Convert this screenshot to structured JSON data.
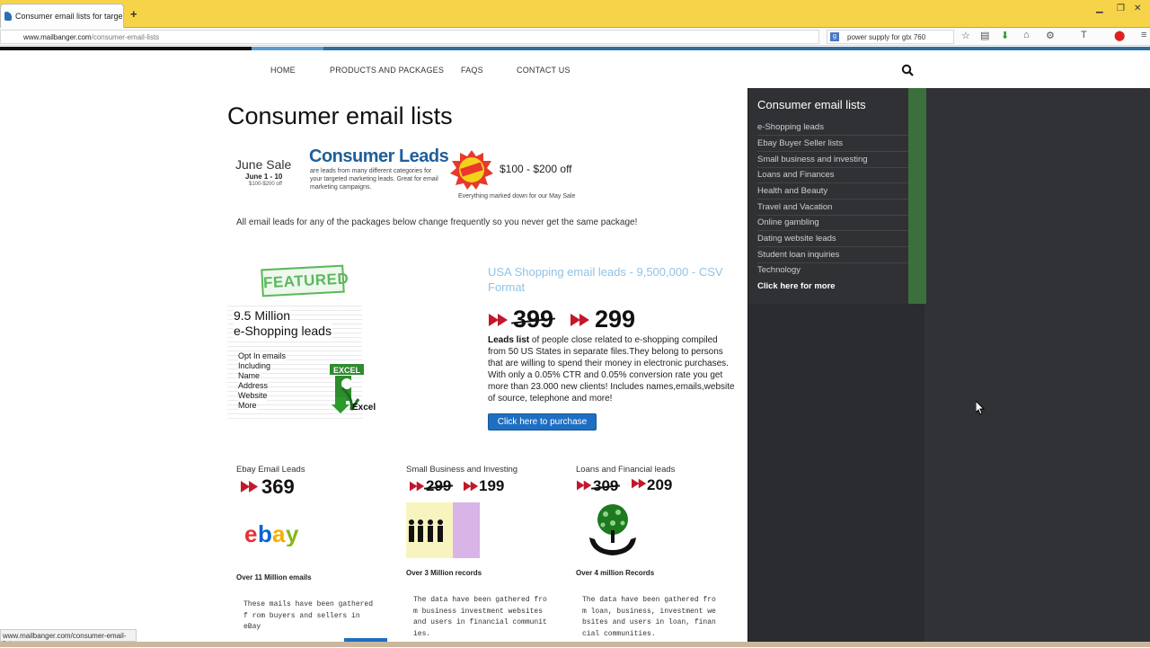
{
  "browser": {
    "tab_title": "Consumer email lists for targe...",
    "url_domain": "www.mailbanger.com",
    "url_path": "/consumer-email-lists",
    "search_value": "power supply for gtx 760",
    "status_url": "www.mailbanger.com/consumer-email-lists"
  },
  "nav": {
    "home": "HOME",
    "products": "PRODUCTS AND PACKAGES",
    "faqs": "FAQS",
    "contact": "CONTACT US"
  },
  "page": {
    "title": "Consumer email lists",
    "banner": {
      "june_sale": "June Sale",
      "june_dates": "June 1 - 10",
      "june_off": "$100-$200 off",
      "consumer_leads": "Consumer Leads",
      "consumer_desc": "are leads from many different categories for your targeted marketing leads. Great for email marketing campaigns.",
      "off_text": "$100 - $200 off",
      "marked": "Everything marked down for our May Sale"
    },
    "all_leads_text": "All email leads for any of the packages below change frequently so you never get the same package!",
    "featured": {
      "badge": "FEATURED",
      "line1": "9.5 Million",
      "line2": "e-Shopping leads",
      "list": [
        "Opt In emails",
        "Including",
        "Name",
        "Address",
        "Website",
        "More"
      ],
      "excel_label": "EXCEL",
      "excel_word": "Excel",
      "title": "USA Shopping email leads - 9,500,000 - CSV Format",
      "old_price": "399",
      "new_price": "299",
      "desc_bold": "Leads list",
      "desc": " of people close related to e-shopping compiled from 50 US States in separate files.They belong to persons that are willing to spend their money in electronic purchases. With only a 0.05% CTR and 0.05% conversion rate you get more than 23.000 new clients! Includes names,emails,website of source, telephone and more!",
      "buy_label": "Click here to purchase"
    },
    "products": [
      {
        "title": "Ebay Email Leads",
        "price": "369",
        "stat": "Over 11 Million emails",
        "desc": "These mails have been gathered f rom buyers and sellers in eBay"
      },
      {
        "title": "Small Business and Investing",
        "old_price": "299",
        "price": "199",
        "stat": "Over 3 Million records",
        "desc": "The data have been gathered fro m business investment websites and users in financial communit ies."
      },
      {
        "title": "Loans and Financial leads",
        "old_price": "309",
        "price": "209",
        "stat": "Over 4 million Records",
        "desc": "The data have been gathered fro m loan, business, investment we bsites and users in loan, finan cial communities."
      }
    ]
  },
  "sidebar": {
    "title": "Consumer email lists",
    "items": [
      "e-Shopping leads",
      "Ebay Buyer Seller lists",
      "Small business and investing",
      "Loans and Finances",
      "Health and Beauty",
      "Travel and Vacation",
      "Online gambling",
      "Dating website leads",
      "Student loan inquiries",
      "Technology"
    ],
    "more": "Click here for more"
  },
  "colors": {
    "accent": "#1e6fc2",
    "sidebar_bg": "#2a2c2f",
    "green": "#3b6f3c",
    "arrow_red": "#c2182b"
  }
}
